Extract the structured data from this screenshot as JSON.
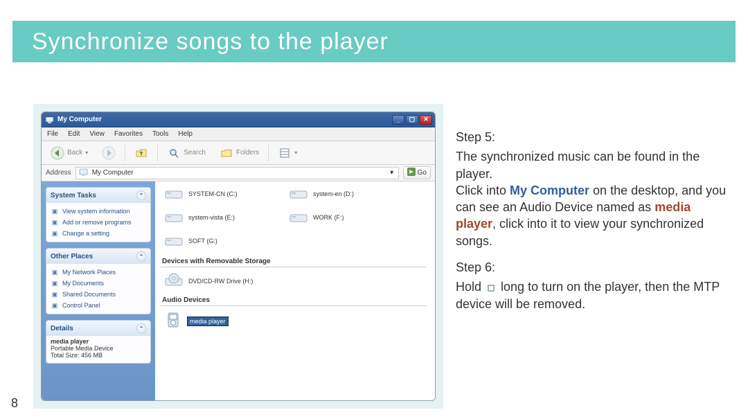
{
  "page_number": "8",
  "header": {
    "title": "Synchronize songs to the player"
  },
  "screenshot": {
    "window_title": "My Computer",
    "menubar": [
      "File",
      "Edit",
      "View",
      "Favorites",
      "Tools",
      "Help"
    ],
    "toolbar": {
      "back": "Back",
      "search": "Search",
      "folders": "Folders"
    },
    "addressbar": {
      "label": "Address",
      "value": "My Computer",
      "go": "Go"
    },
    "sidebar": {
      "system_tasks": {
        "title": "System Tasks",
        "items": [
          "View system information",
          "Add or remove programs",
          "Change a setting"
        ]
      },
      "other_places": {
        "title": "Other Places",
        "items": [
          "My Network Places",
          "My Documents",
          "Shared Documents",
          "Control Panel"
        ]
      },
      "details": {
        "title": "Details",
        "name": "media player",
        "type": "Portable Media Device",
        "size_label": "Total Size: 456 MB"
      }
    },
    "main": {
      "drives": [
        {
          "label": "SYSTEM-CN (C:)"
        },
        {
          "label": "system-en (D:)"
        },
        {
          "label": "system-vista (E:)"
        },
        {
          "label": "WORK (F:)"
        },
        {
          "label": "SOFT (G:)"
        }
      ],
      "section_removable": "Devices with Removable Storage",
      "removable": [
        {
          "label": "DVD/CD-RW Drive (H:)"
        }
      ],
      "section_audio": "Audio Devices",
      "audio": [
        {
          "label": "media player"
        }
      ]
    }
  },
  "instructions": {
    "step5_head": "Step 5:",
    "step5_l1": "The synchronized music can be found in the player.",
    "step5_l2a": "Click into ",
    "step5_kw1": "My Computer",
    "step5_l2b": " on the desktop, and you can see an Audio Device named as ",
    "step5_kw2": "media player",
    "step5_l2c": ", click into it to view your synchronized songs.",
    "step6_head": "Step 6:",
    "step6_a": "Hold ",
    "step6_b": " long to turn on the player, then the MTP device will be removed."
  }
}
